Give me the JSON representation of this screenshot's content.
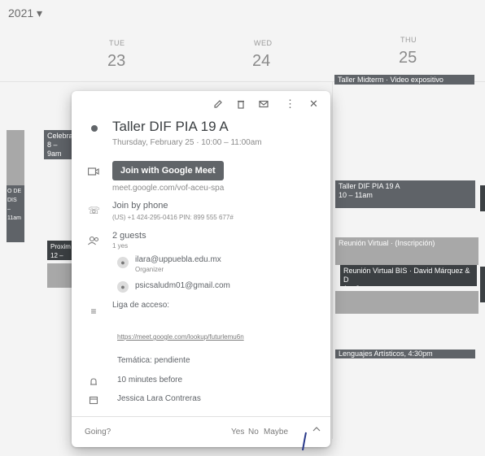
{
  "header": {
    "year": "2021 ▾"
  },
  "days": [
    {
      "name": "TUE",
      "num": "23"
    },
    {
      "name": "WED",
      "num": "24"
    },
    {
      "name": "THU",
      "num": "25"
    }
  ],
  "events": {
    "thu_top": "Taller Midterm · Video expositivo",
    "left1": "Celebra\n8 – 9am",
    "left2": "O DE DIS\n– 11am",
    "left3": "Proxim\n12 – 12",
    "thu_mid": "Taller DIF PIA 19 A\n10 – 11am",
    "thu_lilac": "Reunión Virtual · (Inscripción)",
    "thu_dark": "Reunión Virtual BIS · David Márquez & D\n1 – 2pm",
    "thu_bottom": "Lenguajes Artísticos, 4:30pm"
  },
  "popup": {
    "title": "Taller DIF PIA 19 A",
    "datetime": "Thursday, February 25 · 10:00 – 11:00am",
    "meet_button": "Join with Google Meet",
    "meet_link": "meet.google.com/vof-aceu-spa",
    "phone_title": "Join by phone",
    "phone_number": "(US) +1 424-295-0416 PIN: 899 555 677#",
    "guests_title": "2 guests",
    "guests_sub": "1 yes",
    "guest1": "ilara@uppuebla.edu.mx",
    "guest1_role": "Organizer",
    "guest2": "psicsaludm01@gmail.com",
    "description_label": "Liga de acceso:",
    "description_link": "https://meet.google.com/lookup/futurlemu6n",
    "description_extra": "Temática: pendiente",
    "reminder": "10 minutes before",
    "calendar": "Jessica Lara Contreras",
    "footer_going": "Going?",
    "footer_yes": "Yes",
    "footer_no": "No",
    "footer_maybe": "Maybe",
    "toolbar_icons": [
      "pencil-icon",
      "trash-icon",
      "email-icon",
      "more-vert-icon",
      "close-icon"
    ]
  },
  "colors": {
    "dark_event": "#5f6368",
    "darker_event": "#3c4043",
    "light_event": "#a8a8a8"
  }
}
